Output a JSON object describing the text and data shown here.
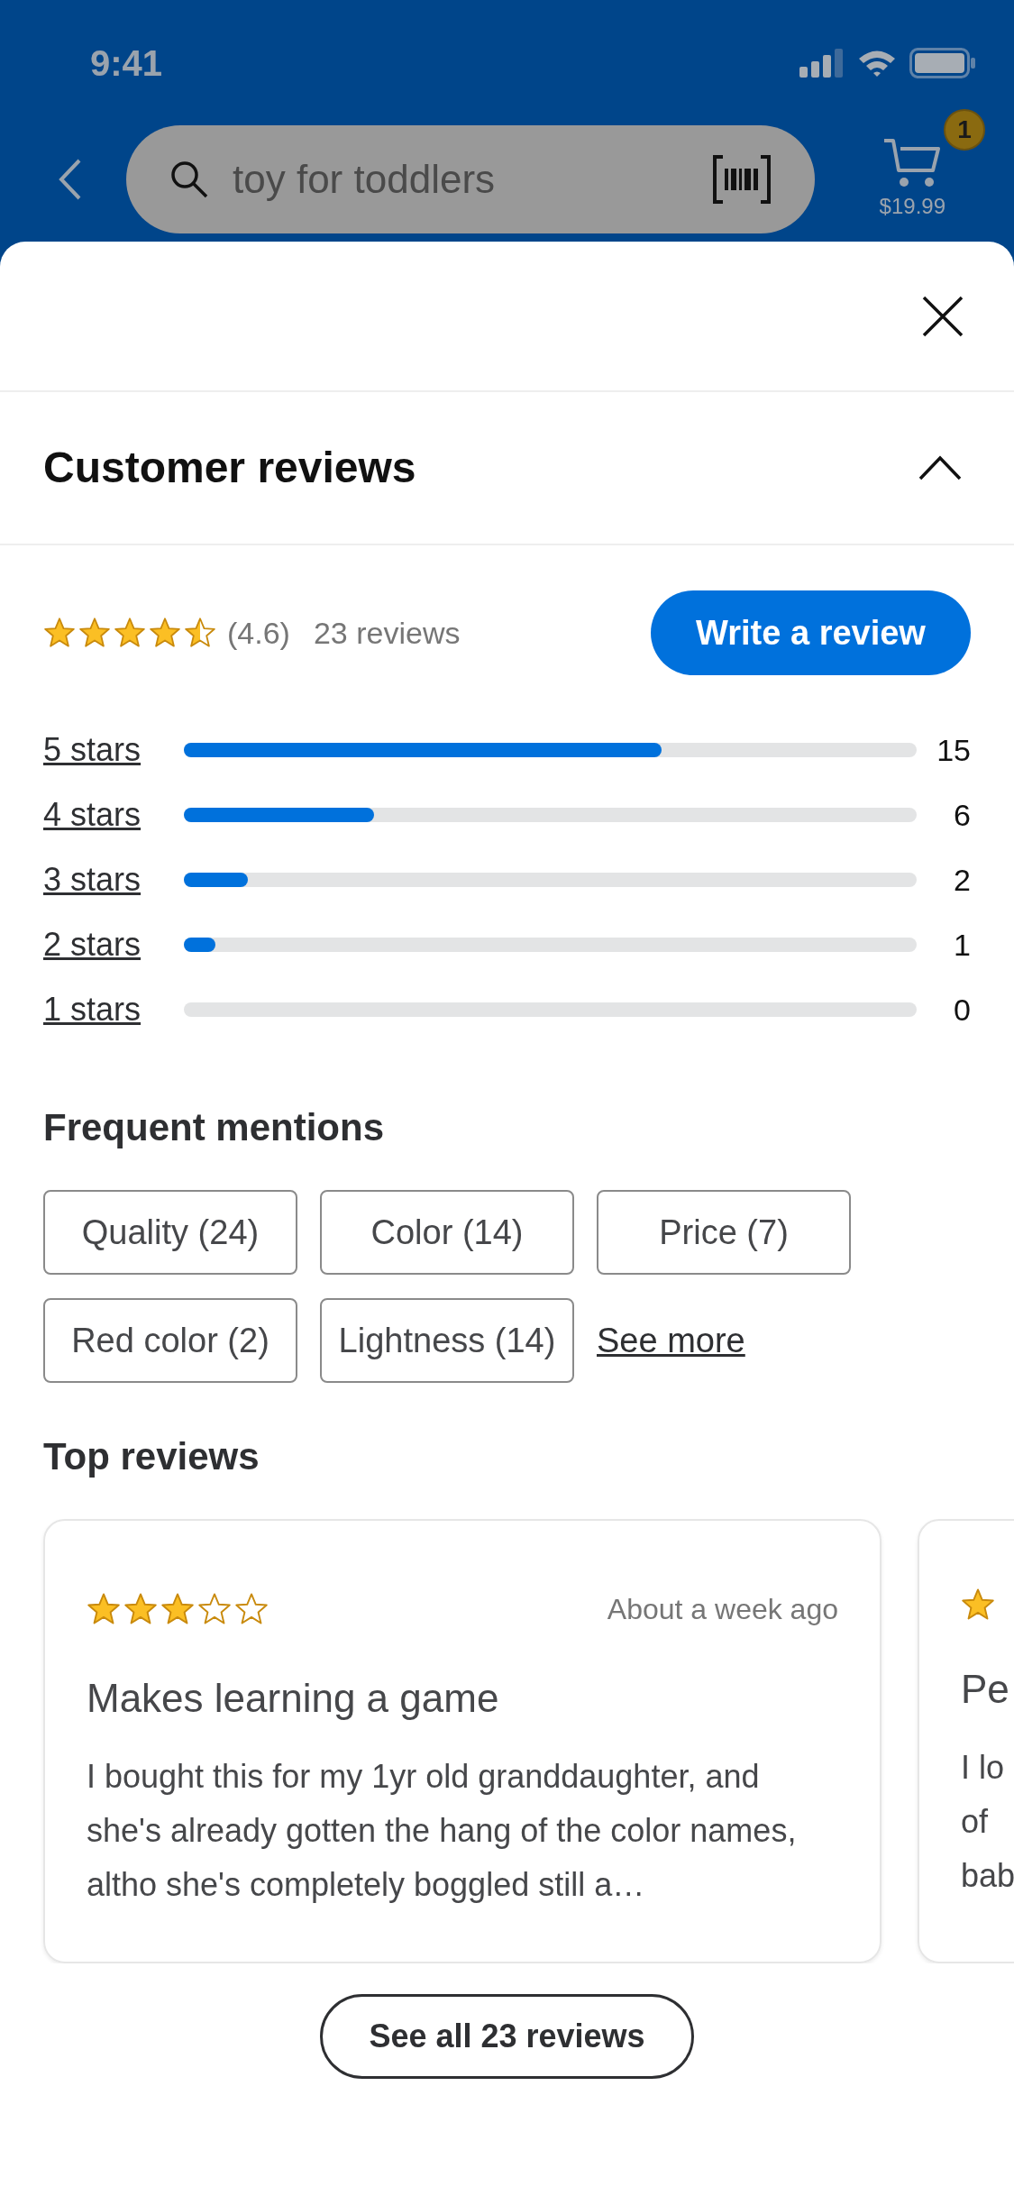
{
  "status_bar": {
    "time": "9:41"
  },
  "search": {
    "value": "toy for toddlers"
  },
  "cart": {
    "badge": "1",
    "total": "$19.99"
  },
  "section": {
    "title": "Customer reviews",
    "expanded": true
  },
  "summary": {
    "stars": 4.5,
    "average": "(4.6)",
    "count": "23 reviews",
    "button": "Write a review"
  },
  "breakdown": [
    {
      "label": "5 stars",
      "level": 0.652,
      "count": "15"
    },
    {
      "label": "4 stars",
      "level": 0.26,
      "count": "6"
    },
    {
      "label": "3 stars",
      "level": 0.087,
      "count": "2"
    },
    {
      "label": "2 stars",
      "level": 0.043,
      "count": "1"
    },
    {
      "label": "1 stars",
      "count": "0"
    }
  ],
  "mentions": {
    "title": "Frequent mentions",
    "chips": [
      "Quality (24)",
      "Color (14)",
      "Price (7)",
      "Red color (2)",
      "Lightness (14)"
    ],
    "more": "See more"
  },
  "top_reviews": {
    "title": "Top reviews",
    "reviews": [
      {
        "stars": 3,
        "date": "About a week ago",
        "title": "Makes learning a game",
        "body": "I bought this for my 1yr old granddaughter, and she's already gotten the hang of the color names, altho she's completely boggled still a…"
      },
      {
        "title": "Pe",
        "body_lines": [
          "I lo",
          "of",
          "bab"
        ]
      }
    ]
  },
  "see_all": "See all 23 reviews"
}
